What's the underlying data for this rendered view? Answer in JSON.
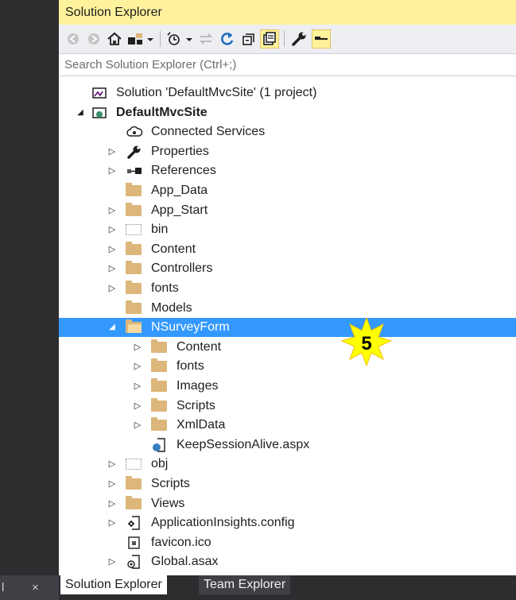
{
  "window": {
    "title": "Solution Explorer"
  },
  "search": {
    "placeholder": "Search Solution Explorer (Ctrl+;)"
  },
  "toolbar": {
    "icons": [
      "back-icon",
      "forward-icon",
      "home-icon",
      "switch-views-icon",
      "dropdown-icon",
      "pending-changes-icon",
      "sync-icon",
      "refresh-icon",
      "collapse-all-icon",
      "show-all-files-icon",
      "properties-icon",
      "preview-icon"
    ]
  },
  "tree": [
    {
      "label": "Solution 'DefaultMvcSite' (1 project)",
      "depth": 0,
      "arrow": "",
      "icon": "solution"
    },
    {
      "label": "DefaultMvcSite",
      "depth": 0,
      "arrow": "expanded",
      "icon": "web-project",
      "bold": true
    },
    {
      "label": "Connected Services",
      "depth": 1,
      "arrow": "",
      "icon": "cloud"
    },
    {
      "label": "Properties",
      "depth": 1,
      "arrow": "collapsed",
      "icon": "wrench"
    },
    {
      "label": "References",
      "depth": 1,
      "arrow": "collapsed",
      "icon": "references"
    },
    {
      "label": "App_Data",
      "depth": 1,
      "arrow": "",
      "icon": "folder"
    },
    {
      "label": "App_Start",
      "depth": 1,
      "arrow": "collapsed",
      "icon": "folder"
    },
    {
      "label": "bin",
      "depth": 1,
      "arrow": "collapsed",
      "icon": "folder-dotted"
    },
    {
      "label": "Content",
      "depth": 1,
      "arrow": "collapsed",
      "icon": "folder"
    },
    {
      "label": "Controllers",
      "depth": 1,
      "arrow": "collapsed",
      "icon": "folder"
    },
    {
      "label": "fonts",
      "depth": 1,
      "arrow": "collapsed",
      "icon": "folder"
    },
    {
      "label": "Models",
      "depth": 1,
      "arrow": "",
      "icon": "folder"
    },
    {
      "label": "NSurveyForm",
      "depth": 1,
      "arrow": "expanded",
      "icon": "folder-open",
      "selected": true
    },
    {
      "label": "Content",
      "depth": 2,
      "arrow": "collapsed",
      "icon": "folder"
    },
    {
      "label": "fonts",
      "depth": 2,
      "arrow": "collapsed",
      "icon": "folder"
    },
    {
      "label": "Images",
      "depth": 2,
      "arrow": "collapsed",
      "icon": "folder"
    },
    {
      "label": "Scripts",
      "depth": 2,
      "arrow": "collapsed",
      "icon": "folder"
    },
    {
      "label": "XmlData",
      "depth": 2,
      "arrow": "collapsed",
      "icon": "folder"
    },
    {
      "label": "KeepSessionAlive.aspx",
      "depth": 2,
      "arrow": "",
      "icon": "aspx"
    },
    {
      "label": "obj",
      "depth": 1,
      "arrow": "collapsed",
      "icon": "folder-dotted"
    },
    {
      "label": "Scripts",
      "depth": 1,
      "arrow": "collapsed",
      "icon": "folder"
    },
    {
      "label": "Views",
      "depth": 1,
      "arrow": "collapsed",
      "icon": "folder"
    },
    {
      "label": "ApplicationInsights.config",
      "depth": 1,
      "arrow": "collapsed",
      "icon": "config"
    },
    {
      "label": "favicon.ico",
      "depth": 1,
      "arrow": "",
      "icon": "ico-file"
    },
    {
      "label": "Global.asax",
      "depth": 1,
      "arrow": "collapsed",
      "icon": "asax"
    }
  ],
  "callout": {
    "number": "5"
  },
  "bottom_tabs": [
    {
      "label": "Solution Explorer",
      "active": true
    },
    {
      "label": "Team Explorer",
      "active": false
    }
  ],
  "left_strip": {
    "close_glyph": "×",
    "fragment": "l"
  },
  "colors": {
    "title_bg": "#fff29d",
    "selection": "#3399ff",
    "folder": "#dcb67a",
    "badge": "#ffff00"
  }
}
